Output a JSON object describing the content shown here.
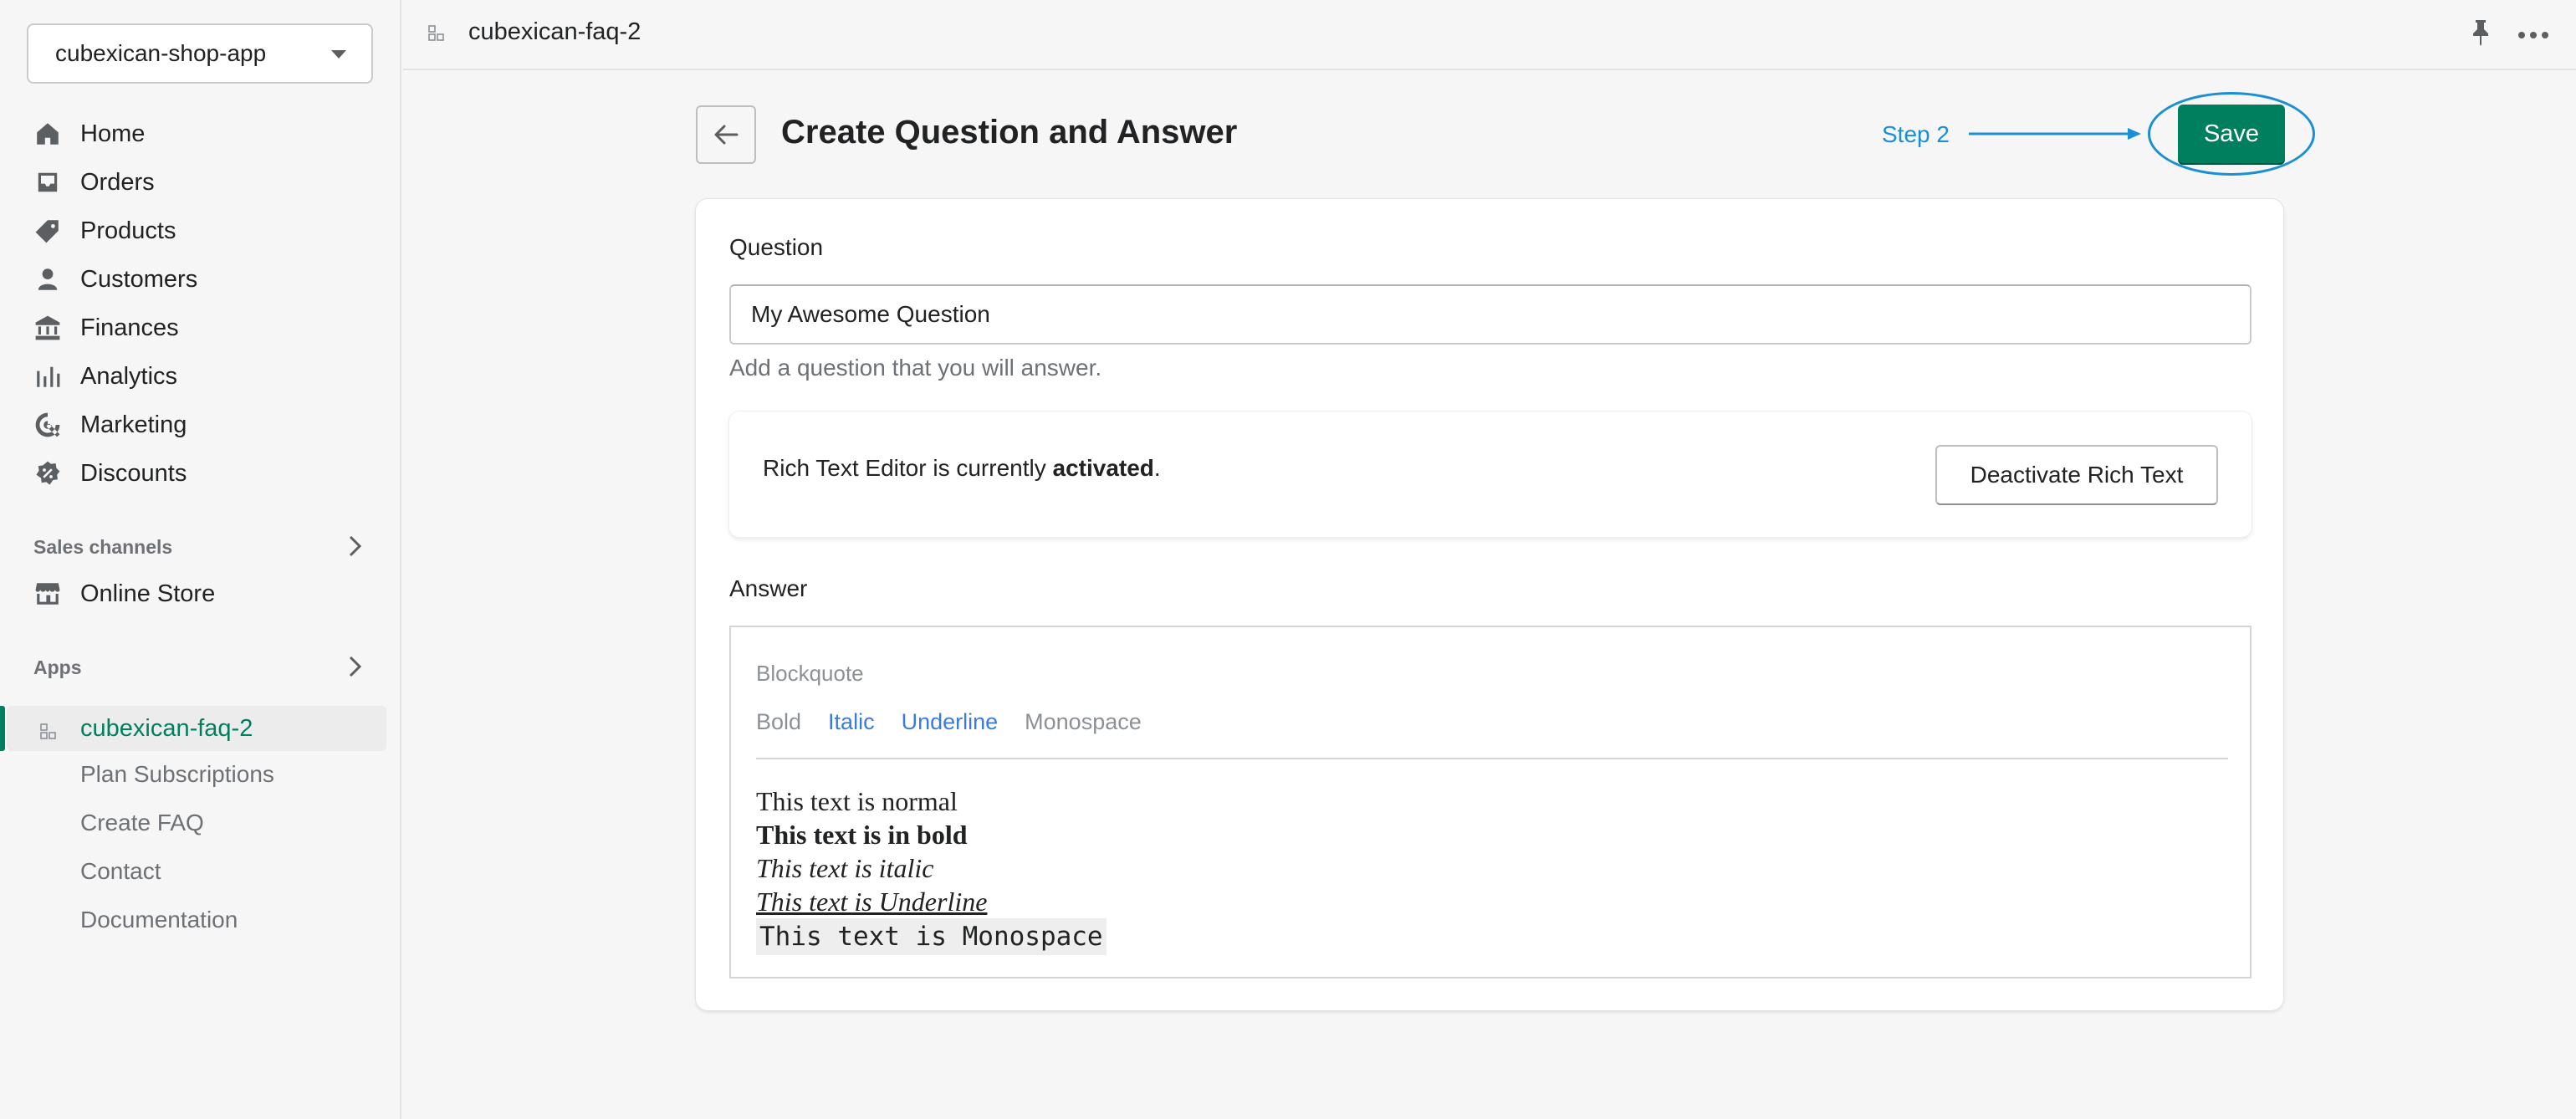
{
  "store": {
    "name": "cubexican-shop-app"
  },
  "nav": {
    "items": [
      {
        "label": "Home",
        "icon": "home-icon"
      },
      {
        "label": "Orders",
        "icon": "orders-icon"
      },
      {
        "label": "Products",
        "icon": "tag-icon"
      },
      {
        "label": "Customers",
        "icon": "person-icon"
      },
      {
        "label": "Finances",
        "icon": "bank-icon"
      },
      {
        "label": "Analytics",
        "icon": "bar-chart-icon"
      },
      {
        "label": "Marketing",
        "icon": "target-icon"
      },
      {
        "label": "Discounts",
        "icon": "discount-icon"
      }
    ],
    "sales_channels_title": "Sales channels",
    "online_store": "Online Store",
    "apps_title": "Apps",
    "app_name": "cubexican-faq-2",
    "app_subitems": [
      "Plan Subscriptions",
      "Create FAQ",
      "Contact",
      "Documentation"
    ]
  },
  "topbar": {
    "app_name": "cubexican-faq-2"
  },
  "header": {
    "title": "Create Question and Answer",
    "step_label": "Step 2",
    "save_label": "Save"
  },
  "form": {
    "question_label": "Question",
    "question_value": "My Awesome Question",
    "question_help": "Add a question that you will answer.",
    "rich_text_msg_prefix": "Rich Text Editor is currently ",
    "rich_text_msg_state": "activated",
    "rich_text_msg_suffix": ".",
    "deactivate_label": "Deactivate Rich Text",
    "answer_label": "Answer"
  },
  "editor": {
    "toolbar": {
      "blockquote": "Blockquote",
      "bold": "Bold",
      "italic": "Italic",
      "underline": "Underline",
      "monospace": "Monospace"
    },
    "content": {
      "normal": "This text is normal",
      "bold": "This text is in bold",
      "italic": "This text is italic",
      "underline": "This text is Underline",
      "monospace": "This text is Monospace"
    }
  },
  "colors": {
    "primary": "#007f5f",
    "annotation": "#1a8fd3",
    "toolbar_active": "#3b7be0"
  }
}
